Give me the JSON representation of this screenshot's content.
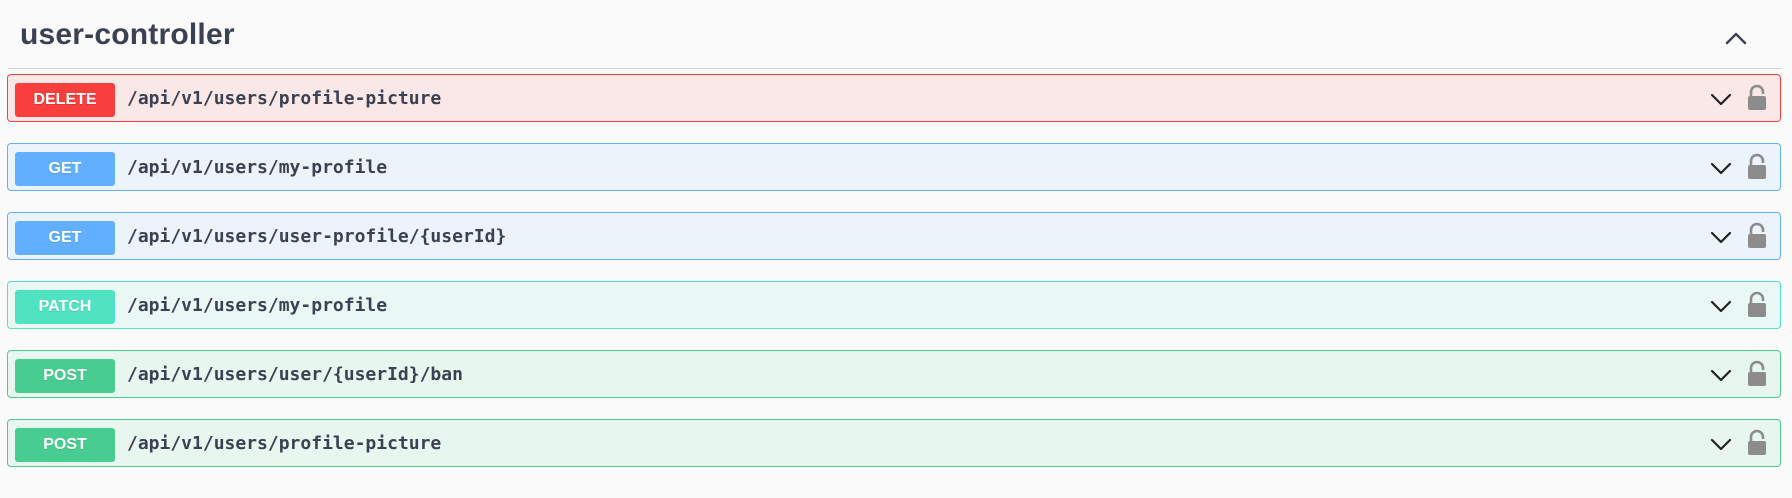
{
  "tag": {
    "title": "user-controller"
  },
  "operations": [
    {
      "method": "DELETE",
      "path": "/api/v1/users/profile-picture"
    },
    {
      "method": "GET",
      "path": "/api/v1/users/my-profile"
    },
    {
      "method": "GET",
      "path": "/api/v1/users/user-profile/{userId}"
    },
    {
      "method": "PATCH",
      "path": "/api/v1/users/my-profile"
    },
    {
      "method": "POST",
      "path": "/api/v1/users/user/{userId}/ban"
    },
    {
      "method": "POST",
      "path": "/api/v1/users/profile-picture"
    }
  ],
  "colors": {
    "delete": "#f93e3e",
    "get": "#61affe",
    "patch": "#50e3c2",
    "post": "#49cc90",
    "text": "#3b4151"
  },
  "icons": {
    "collapse": "chevron-up-icon",
    "expand": "chevron-down-icon",
    "auth": "lock-icon"
  }
}
